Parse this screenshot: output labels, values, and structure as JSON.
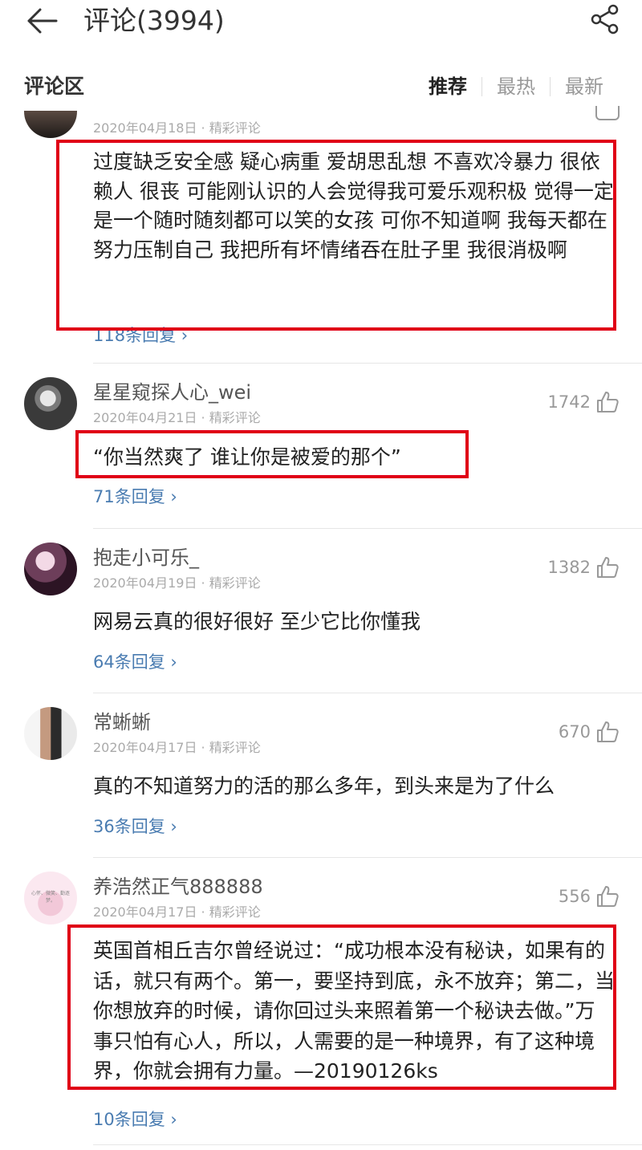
{
  "header": {
    "title": "评论(3994)"
  },
  "section": {
    "title": "评论区",
    "tabs": [
      "推荐",
      "最热",
      "最新"
    ],
    "active_tab": "推荐"
  },
  "comments": [
    {
      "meta": "2020年04月18日 · 精彩评论",
      "text": "过度缺乏安全感 疑心病重 爱胡思乱想 不喜欢冷暴力 很依赖人 很丧 可能刚认识的人会觉得我可爱乐观积极 觉得一定是一个随时随刻都可以笑的女孩 可你不知道啊 我每天都在努力压制自己 我把所有坏情绪吞在肚子里 我很消极啊",
      "replies": "118条回复 ›"
    },
    {
      "username": "星星窥探人心_wei",
      "meta": "2020年04月21日 · 精彩评论",
      "likes": "1742",
      "text": "“你当然爽了 谁让你是被爱的那个”",
      "replies": "71条回复 ›"
    },
    {
      "username": "抱走小可乐_",
      "meta": "2020年04月19日 · 精彩评论",
      "likes": "1382",
      "text": "网易云真的很好很好 至少它比你懂我",
      "replies": "64条回复 ›"
    },
    {
      "username": "常蜥蜥",
      "meta": "2020年04月17日 · 精彩评论",
      "likes": "670",
      "text": "真的不知道努力的活的那么多年，到头来是为了什么",
      "replies": "36条回复 ›"
    },
    {
      "username": "养浩然正气888888",
      "meta": "2020年04月17日 · 精彩评论",
      "likes": "556",
      "avatar_text": "心怀、微笑、勤逐梦。",
      "text": "英国首相丘吉尔曾经说过：“成功根本没有秘诀，如果有的话，就只有两个。第一，要坚持到底，永不放弃；第二，当你想放弃的时候，请你回过头来照着第一个秘诀去做。”万事只怕有心人，所以，人需要的是一种境界，有了这种境界，你就会拥有力量。—20190126ks",
      "replies": "10条回复 ›"
    }
  ],
  "colors": {
    "highlight": "#e00016",
    "link": "#4a7cb1"
  }
}
